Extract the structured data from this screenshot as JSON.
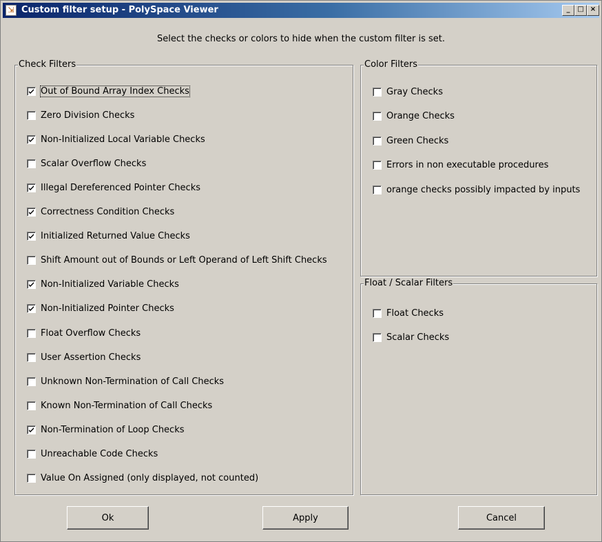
{
  "window": {
    "title": "Custom filter setup - PolySpace Viewer",
    "controls": {
      "minimize": "_",
      "maximize": "□",
      "close": "×"
    }
  },
  "instruction": "Select the checks or colors to hide when the custom filter is set.",
  "check_filters": {
    "title": "Check Filters",
    "items": [
      {
        "label": "Out of Bound Array Index Checks",
        "checked": true,
        "focused": true
      },
      {
        "label": "Zero Division Checks",
        "checked": false
      },
      {
        "label": "Non-Initialized Local Variable Checks",
        "checked": true
      },
      {
        "label": "Scalar Overflow Checks",
        "checked": false
      },
      {
        "label": "Illegal Dereferenced Pointer Checks",
        "checked": true
      },
      {
        "label": "Correctness Condition Checks",
        "checked": true
      },
      {
        "label": "Initialized Returned Value Checks",
        "checked": true
      },
      {
        "label": "Shift Amount out of Bounds or Left Operand of Left Shift Checks",
        "checked": false
      },
      {
        "label": "Non-Initialized Variable Checks",
        "checked": true
      },
      {
        "label": "Non-Initialized Pointer Checks",
        "checked": true
      },
      {
        "label": "Float Overflow Checks",
        "checked": false
      },
      {
        "label": "User Assertion Checks",
        "checked": false
      },
      {
        "label": "Unknown Non-Termination of Call Checks",
        "checked": false
      },
      {
        "label": "Known Non-Termination of Call Checks",
        "checked": false
      },
      {
        "label": "Non-Termination of Loop Checks",
        "checked": true
      },
      {
        "label": "Unreachable Code Checks",
        "checked": false
      },
      {
        "label": "Value On Assigned (only displayed, not counted)",
        "checked": false
      }
    ]
  },
  "color_filters": {
    "title": "Color Filters",
    "items": [
      {
        "label": "Gray Checks",
        "checked": false
      },
      {
        "label": "Orange  Checks",
        "checked": false
      },
      {
        "label": "Green Checks",
        "checked": false
      },
      {
        "label": "Errors in non executable procedures",
        "checked": false
      },
      {
        "label": "orange checks possibly impacted by inputs",
        "checked": false
      }
    ]
  },
  "float_scalar_filters": {
    "title": "Float / Scalar Filters",
    "items": [
      {
        "label": "Float Checks",
        "checked": false
      },
      {
        "label": "Scalar Checks",
        "checked": false
      }
    ]
  },
  "buttons": {
    "ok": "Ok",
    "apply": "Apply",
    "cancel": "Cancel"
  }
}
